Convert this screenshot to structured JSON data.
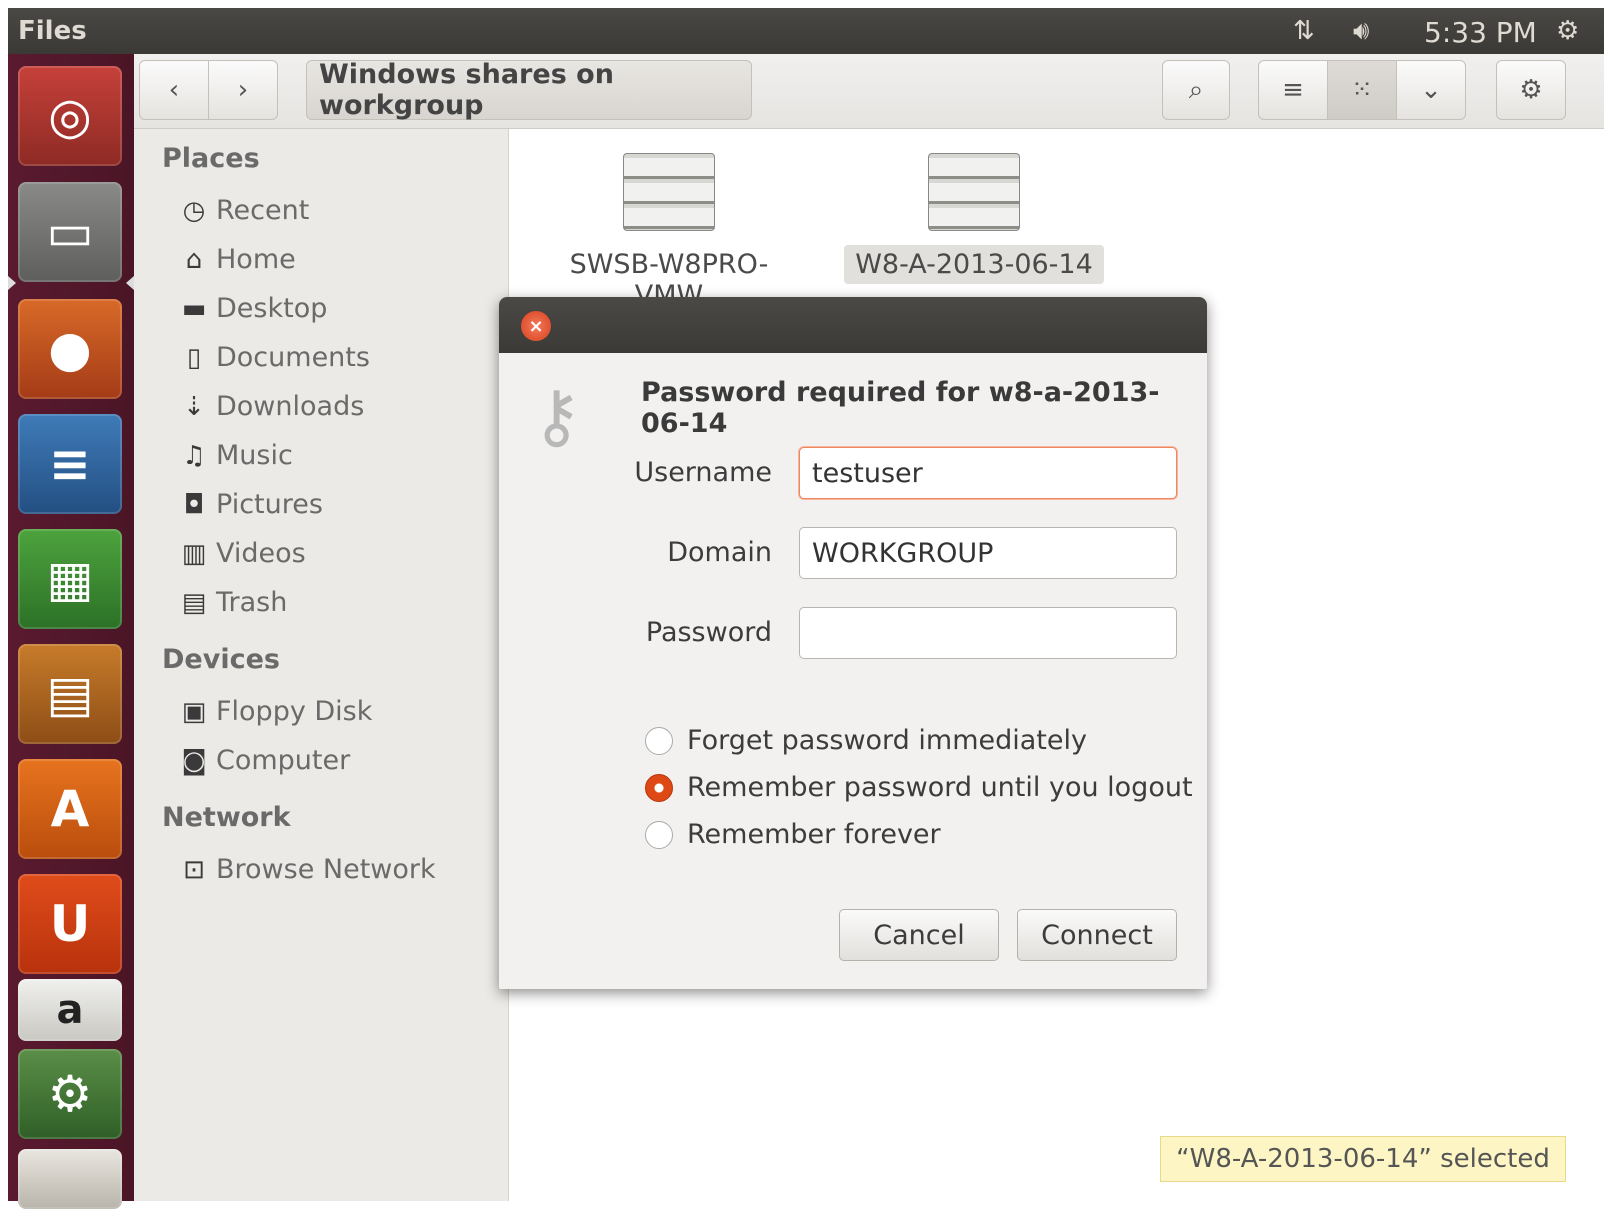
{
  "top_panel": {
    "app_title": "Files",
    "clock": "5:33 PM"
  },
  "launcher": {
    "items": [
      "Dash",
      "Files",
      "Firefox",
      "Writer",
      "Calc",
      "Impress",
      "Software Center",
      "Ubuntu One",
      "Amazon",
      "Tweak",
      "Trash"
    ]
  },
  "toolbar": {
    "location": "Windows shares on workgroup"
  },
  "sidebar": {
    "places_heading": "Places",
    "places": [
      "Recent",
      "Home",
      "Desktop",
      "Documents",
      "Downloads",
      "Music",
      "Pictures",
      "Videos",
      "Trash"
    ],
    "devices_heading": "Devices",
    "devices": [
      "Floppy Disk",
      "Computer"
    ],
    "network_heading": "Network",
    "network": [
      "Browse Network"
    ]
  },
  "content": {
    "servers": [
      "SWSB-W8PRO-VMW",
      "W8-A-2013-06-14"
    ]
  },
  "dialog": {
    "heading": "Password required for w8-a-2013-06-14",
    "username_label": "Username",
    "username_value": "testuser",
    "domain_label": "Domain",
    "domain_value": "WORKGROUP",
    "password_label": "Password",
    "password_value": "",
    "options": [
      "Forget password immediately",
      "Remember password until you logout",
      "Remember forever"
    ],
    "selected_option_index": 1,
    "cancel_label": "Cancel",
    "connect_label": "Connect"
  },
  "status": {
    "text": "“W8-A-2013-06-14” selected"
  },
  "colors": {
    "accent": "#dd4814",
    "launcher_bg": "#5a1a2f",
    "panel_bg": "#3c3b37"
  }
}
